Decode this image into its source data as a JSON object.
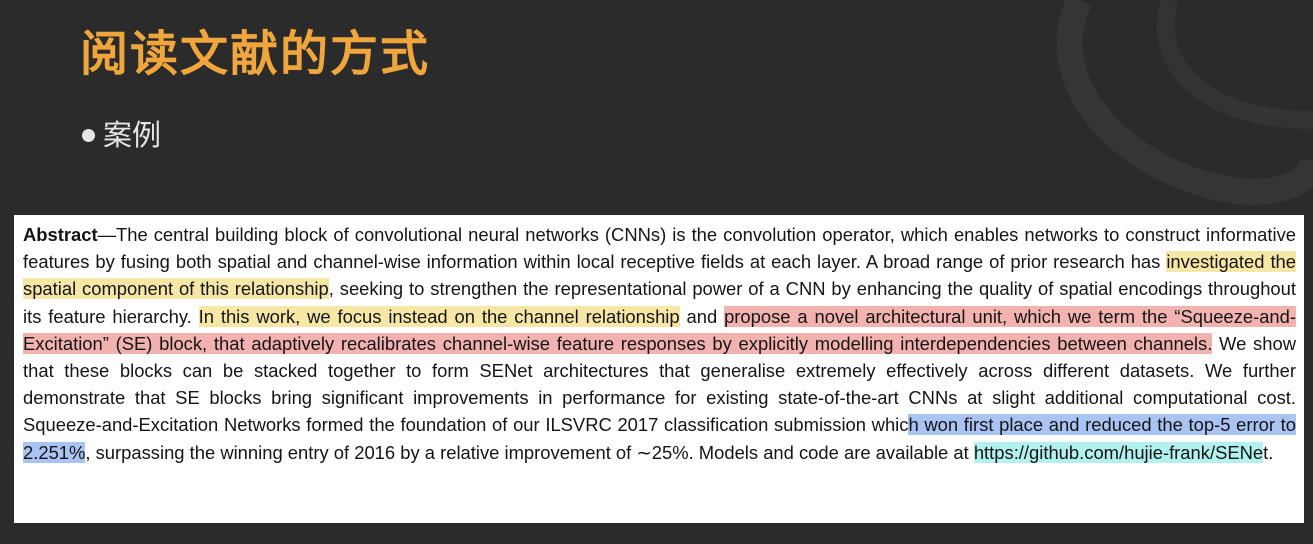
{
  "slide": {
    "title": "阅读文献的方式",
    "bullet": "案例"
  },
  "colors": {
    "title": "#f0a63c",
    "background": "#2b2b2b",
    "highlight_yellow": "#f6e7a6",
    "highlight_red": "#f1b2b0",
    "highlight_blue": "#a9c3f3",
    "highlight_cyan": "#b2f1ee"
  },
  "abstract": {
    "label": "Abstract",
    "dash": "—",
    "s1": "The central building block of convolutional neural networks (CNNs) is the convolution operator, which enables networks to construct informative features by fusing both spatial and channel-wise information within local receptive fields at each layer. A broad range of prior research has ",
    "s2_yellow": "investigated the spatial component of this relationship",
    "s3": ", seeking to strengthen the representational power of a CNN by enhancing the quality of spatial encodings throughout its feature hierarchy. ",
    "s4_yellow": "In this work, we focus instead on the channel relationship",
    "s5": " and ",
    "s6_red": "propose a novel architectural unit, which we term the “Squeeze-and-Excitation” (SE) block, that adaptively recalibrates channel-wise feature responses by explicitly modelling interdependencies between channels.",
    "s7": " We show that these blocks can be stacked together to form SENet architectures that generalise extremely effectively across different datasets. We further demonstrate that SE blocks bring significant improvements in performance for existing state-of-the-art CNNs at slight additional computational cost. Squeeze-and-Excitation Networks formed the foundation of our ILSVRC 2017 classification submission whic",
    "s8_blue": "h won first place and reduced the top-5 error to 2.251%",
    "s9": ", surpassing the winning entry of 2016 by a relative improvement of ∼25%. Models and code are available at ",
    "s10_cyan": "https://github.com/hujie-frank/SENe",
    "s11": "t."
  }
}
